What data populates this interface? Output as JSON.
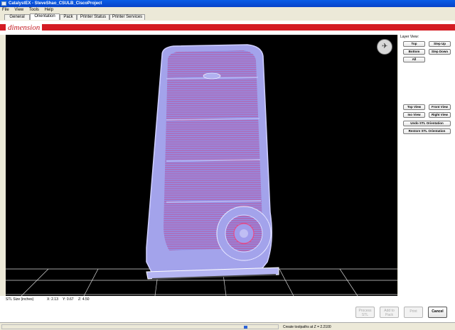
{
  "window": {
    "title": "CatalystEX - SteveShao_CSULB_CiscoProject"
  },
  "menu": [
    "File",
    "View",
    "Tools",
    "Help"
  ],
  "tabs": [
    "General",
    "Orientation",
    "Pack",
    "Printer Status",
    "Printer Services"
  ],
  "active_tab": "Orientation",
  "brand": {
    "logo": "dimension",
    "accent": "#d41c24"
  },
  "layer_view": {
    "label": "Layer View:",
    "buttons": {
      "top": "Top",
      "step_up": "Step Up",
      "bottom": "Bottom",
      "step_down": "Step Down",
      "all": "All"
    }
  },
  "views": {
    "top_view": "Top View",
    "front_view": "Front View",
    "iso_view": "Iso View",
    "right_view": "Right View",
    "undo": "Undo STL Orientation",
    "restore": "Restore STL Orientation"
  },
  "stl_size": {
    "label": "STL Size (inches)",
    "x": "X: 2.13",
    "y": "Y: 0.67",
    "z": "Z: 4.50"
  },
  "actions": {
    "process": "Process STL",
    "add_to_pack": "Add to Pack",
    "print": "Print",
    "cancel": "Cancel"
  },
  "status": {
    "text": "Create toolpaths at Z = 2.2100",
    "progress": 0.87
  },
  "icons": {
    "orientation_widget": "orientation-axes-icon"
  }
}
